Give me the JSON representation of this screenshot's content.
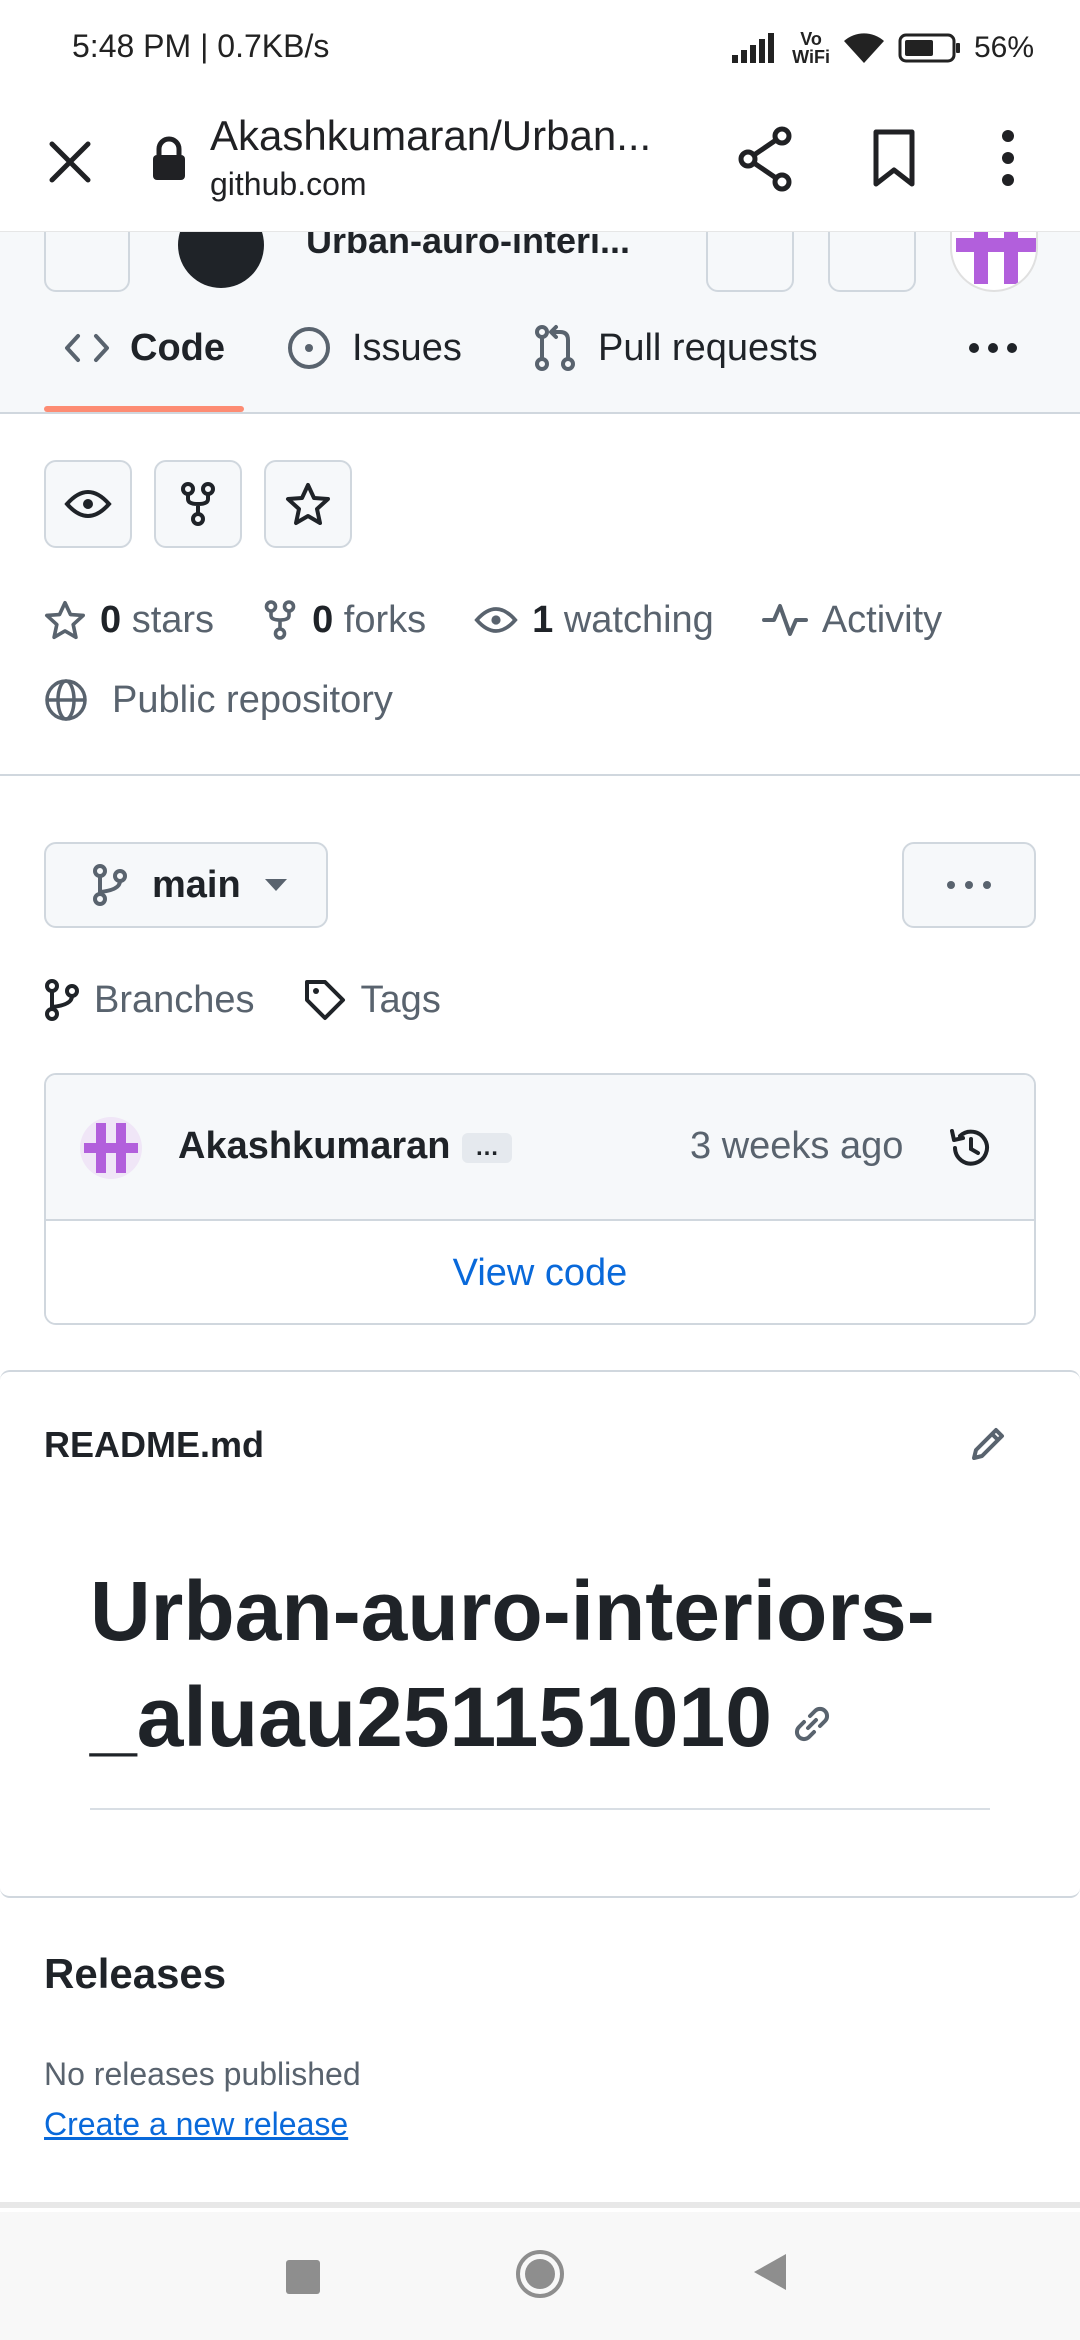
{
  "status_bar": {
    "time_speed": "5:48 PM | 0.7KB/s",
    "vowifi_top": "Vo",
    "vowifi_bottom": "WiFi",
    "battery": "56%"
  },
  "browser": {
    "page_title": "Akashkumaran/Urban...",
    "domain": "github.com"
  },
  "repo_header": {
    "name_cut": "Urban-auro-interi..."
  },
  "tabs": [
    {
      "label": "Code",
      "active": true
    },
    {
      "label": "Issues",
      "active": false
    },
    {
      "label": "Pull requests",
      "active": false
    }
  ],
  "stats": {
    "stars_count": "0",
    "stars_label": "stars",
    "forks_count": "0",
    "forks_label": "forks",
    "watching_count": "1",
    "watching_label": "watching",
    "activity_label": "Activity",
    "visibility": "Public repository"
  },
  "branch": {
    "current": "main",
    "branches_label": "Branches",
    "tags_label": "Tags"
  },
  "commit": {
    "author": "Akashkumaran",
    "dots": "…",
    "time": "3 weeks ago",
    "view_code": "View code"
  },
  "readme": {
    "filename": "README.md",
    "heading": "Urban-auro-interiors-_aluau251151010"
  },
  "releases": {
    "title": "Releases",
    "none_text": "No releases published",
    "create_link": "Create a new release"
  },
  "colors": {
    "accent_link": "#0969da",
    "tab_underline": "#fd8c73",
    "avatar_purple": "#b25fdc"
  }
}
